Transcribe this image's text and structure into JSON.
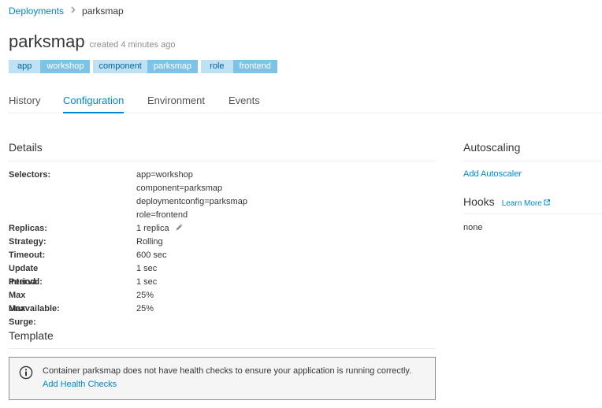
{
  "breadcrumb": {
    "parent": "Deployments",
    "current": "parksmap"
  },
  "header": {
    "title": "parksmap",
    "created": "created 4 minutes ago"
  },
  "labels": [
    {
      "key": "app",
      "value": "workshop"
    },
    {
      "key": "component",
      "value": "parksmap"
    },
    {
      "key": "role",
      "value": "frontend"
    }
  ],
  "tabs": [
    {
      "label": "History",
      "active": false
    },
    {
      "label": "Configuration",
      "active": true
    },
    {
      "label": "Environment",
      "active": false
    },
    {
      "label": "Events",
      "active": false
    }
  ],
  "details": {
    "title": "Details",
    "selectors_label": "Selectors:",
    "selectors": [
      "app=workshop",
      "component=parksmap",
      "deploymentconfig=parksmap",
      "role=frontend"
    ],
    "replicas_label": "Replicas:",
    "replicas": "1 replica",
    "strategy_label": "Strategy:",
    "strategy": "Rolling",
    "timeout_label": "Timeout:",
    "timeout": "600 sec",
    "update_period_label": "Update Period:",
    "update_period": "1 sec",
    "interval_label": "Interval:",
    "interval": "1 sec",
    "max_unavailable_label": "Max Unavailable:",
    "max_unavailable": "25%",
    "max_surge_label": "Max Surge:",
    "max_surge": "25%"
  },
  "template": {
    "title": "Template",
    "alert_text": "Container parksmap does not have health checks to ensure your application is running correctly.",
    "alert_link": "Add Health Checks"
  },
  "autoscaling": {
    "title": "Autoscaling",
    "link": "Add Autoscaler"
  },
  "hooks": {
    "title": "Hooks",
    "learn_more": "Learn More",
    "value": "none"
  },
  "colors": {
    "link": "#0088ce",
    "label_key_bg": "#bee1f4",
    "label_value_bg": "#7dc3e8",
    "text": "#363636"
  },
  "icons": [
    "chevron-right-icon",
    "pencil-icon",
    "info-circle-icon",
    "external-link-icon"
  ]
}
